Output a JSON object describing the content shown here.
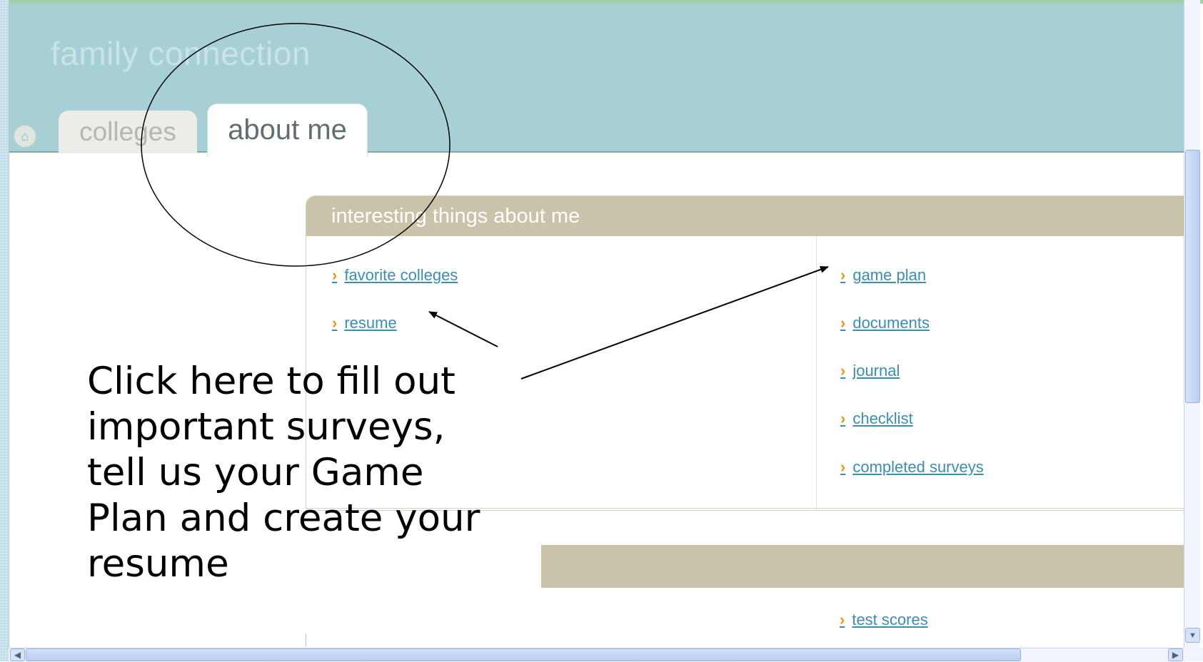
{
  "app": {
    "title": "family connection"
  },
  "nav": {
    "home_icon": "home-icon",
    "tabs": [
      {
        "label": "colleges",
        "active": false
      },
      {
        "label": "about me",
        "active": true
      }
    ]
  },
  "panel": {
    "title": "interesting things about me",
    "left_links": [
      "favorite colleges",
      "resume"
    ],
    "right_links": [
      "game plan",
      "documents",
      "journal",
      "checklist",
      "completed surveys"
    ]
  },
  "panel2": {
    "links": [
      "test scores"
    ]
  },
  "callout": {
    "text": "Click here to fill out important surveys, tell us your Game Plan and create your resume"
  },
  "colors": {
    "header_bg": "#a6d0d6",
    "panel_header_bg": "#c9c4a9",
    "link": "#3a8eb0",
    "chevron": "#e59a1a"
  }
}
